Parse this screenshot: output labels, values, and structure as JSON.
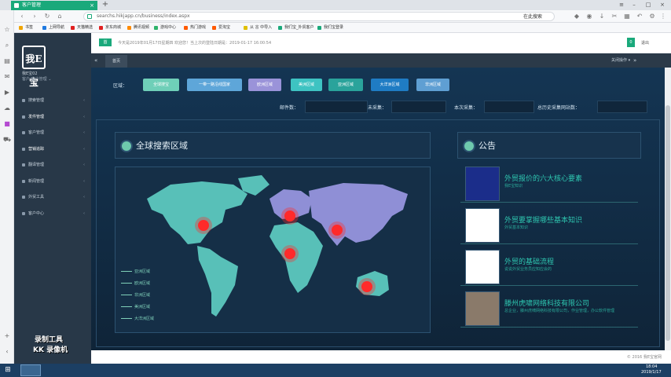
{
  "browser": {
    "tab_title": "客户管理",
    "url": "searchs.hikjapp.cn/business/index.aspx",
    "search_placeholder": "在此搜索",
    "bookmarks": [
      {
        "label": "书签",
        "color": "#f0a500"
      },
      {
        "label": "上网导航",
        "color": "#1f7ae0"
      },
      {
        "label": "天猫精选",
        "color": "#e02020"
      },
      {
        "label": "京东商城",
        "color": "#e02020"
      },
      {
        "label": "腾讯视频",
        "color": "#ff8a00"
      },
      {
        "label": "游戏中心",
        "color": "#2eb36b"
      },
      {
        "label": "热门游戏",
        "color": "#ff5a00"
      },
      {
        "label": "爱淘宝",
        "color": "#ff5a00"
      },
      {
        "label": "从 言 中导入",
        "color": "#e0c000"
      },
      {
        "label": "我们宝_外贸客户",
        "color": "#1aa97b"
      },
      {
        "label": "我们宝登录",
        "color": "#1aa97b"
      }
    ]
  },
  "sidebar": {
    "logo_text": "我E宝",
    "user_name": "我E宝02",
    "user_role": "客户/客户管理 ⌄",
    "items": [
      {
        "label": "搜索管理",
        "active": false
      },
      {
        "label": "发件管理",
        "active": true
      },
      {
        "label": "客户管理",
        "active": false
      },
      {
        "label": "营销追踪",
        "active": true
      },
      {
        "label": "翻译管理",
        "active": false
      },
      {
        "label": "新闻管理",
        "active": false
      },
      {
        "label": "外贸工具",
        "active": false
      },
      {
        "label": "客户中心",
        "active": false
      }
    ],
    "watermark_line1": "录制工具",
    "watermark_line2": "KK 录像机"
  },
  "header": {
    "home_label": "首",
    "notice": "今天是2019年01月17日星期四 欢迎您！当上次的登陆日期是：2019-01-17 16:00:54",
    "message_count": "0",
    "exit_label": "退出"
  },
  "tabs": {
    "home_tab": "首页",
    "ops_label": "关闭操作 ▾"
  },
  "regions": {
    "label": "区域：",
    "buttons": [
      {
        "label": "全球搜宝",
        "color": "#6fcfb8"
      },
      {
        "label": "一带一路沿线国家",
        "color": "#5ea6d9"
      },
      {
        "label": "欧洲区域",
        "color": "#9a93d9"
      },
      {
        "label": "美洲区域",
        "color": "#3ec3c2"
      },
      {
        "label": "亚洲区域",
        "color": "#2aa39b"
      },
      {
        "label": "大洋洲区域",
        "color": "#1f7cc4"
      },
      {
        "label": "非洲区域",
        "color": "#5f9fd3"
      }
    ]
  },
  "stats": {
    "mail_count": "邮件数：",
    "not_collected": "未采集：",
    "this_collect": "本次采集：",
    "total_sites": "总历史采集网站数："
  },
  "map_panel": {
    "title": "全球搜索区域",
    "legend": [
      "亚洲区域",
      "欧洲区域",
      "非洲区域",
      "美洲区域",
      "大洋洲区域"
    ],
    "colors": {
      "land": "#58c0b8",
      "europe_asia": "#8f8fd6",
      "hotspot": "#ff2a2a"
    }
  },
  "notice_panel": {
    "title": "公告",
    "news": [
      {
        "title": "外贸报价的六大核心要素",
        "subtitle": "我E宝知识",
        "thumb_color": "#1b2d8a"
      },
      {
        "title": "外贸要掌握哪些基本知识",
        "subtitle": "外贸基本知识",
        "thumb_color": "#ffffff"
      },
      {
        "title": "外贸的基础流程",
        "subtitle": "说说外贸业务员应知应会的",
        "thumb_color": "#ffffff"
      },
      {
        "title": "滕州虎啸网络科技有限公司",
        "subtitle": "总企业，滕州虎啸网络科技有限公司，作业管理，办公软件管理",
        "thumb_color": "#8a7a6a"
      }
    ]
  },
  "footer": {
    "copyright": "© 2016 我E宝官网"
  },
  "taskbar": {
    "time": "18:04",
    "date": "2019/1/17"
  }
}
